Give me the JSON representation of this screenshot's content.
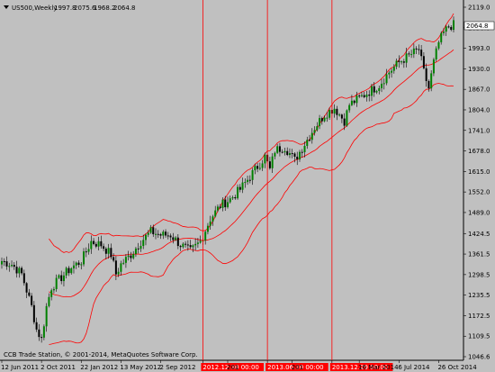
{
  "header": {
    "icon": "dropdown-triangle-icon",
    "symbol": "US500,Weekly",
    "open": "1997.8",
    "high": "2075.6",
    "low": "1968.2",
    "close": "2064.8"
  },
  "footer": {
    "copyright": "CCB Trade Station, © 2001-2014, MetaQuotes Software Corp."
  },
  "current_price_label": "2064.8",
  "colors": {
    "background": "#c0c0c0",
    "bull_candle": "#008000",
    "bear_candle": "#000000",
    "bands": "#ff0000",
    "vertical_lines": "#ff0000",
    "tag_background": "#ff0000",
    "current_tag_background": "#ffffff"
  },
  "vertical_markers": [
    {
      "label": "2012.12.30 00:00"
    },
    {
      "label": "2013.06.30 00:00"
    },
    {
      "label": "2013.12.29 00:00"
    }
  ],
  "chart_data": {
    "type": "candlestick",
    "title": "US500,Weekly",
    "ylim": [
      1046.6,
      2119.0
    ],
    "y_ticks": [
      "2119.0",
      "2056.0",
      "1993.0",
      "1930.0",
      "1867.0",
      "1804.0",
      "1741.0",
      "1678.0",
      "1615.0",
      "1552.0",
      "1489.0",
      "1424.5",
      "1361.5",
      "1298.5",
      "1235.5",
      "1172.5",
      "1109.5",
      "1046.6"
    ],
    "x_ticks": [
      {
        "label": "12 Jun 2011",
        "week": 0
      },
      {
        "label": "2 Oct 2011",
        "week": 16
      },
      {
        "label": "22 Jan 2012",
        "week": 32
      },
      {
        "label": "13 May 2012",
        "week": 48
      },
      {
        "label": "2 Sep 2012",
        "week": 64
      },
      {
        "label": "2012.12.30 00:00",
        "week": 81,
        "marker": true
      },
      {
        "label": "201",
        "week": 91
      },
      {
        "label": "2013.06.30 00:00",
        "week": 107,
        "marker": true
      },
      {
        "label": "201",
        "week": 117
      },
      {
        "label": "2013.12.29 00:00",
        "week": 133,
        "marker": true
      },
      {
        "label": "16 Mar 2014",
        "week": 144
      },
      {
        "label": "6 Jul 2014",
        "week": 160
      },
      {
        "label": "26 Oct 2014",
        "week": 176
      }
    ],
    "indicators": [
      "Bollinger upper",
      "Moving average",
      "Bollinger lower"
    ],
    "approx_close_path": [
      [
        0,
        1340
      ],
      [
        4,
        1330
      ],
      [
        8,
        1300
      ],
      [
        12,
        1200
      ],
      [
        14,
        1130
      ],
      [
        16,
        1100
      ],
      [
        18,
        1200
      ],
      [
        20,
        1260
      ],
      [
        24,
        1290
      ],
      [
        28,
        1320
      ],
      [
        32,
        1340
      ],
      [
        36,
        1400
      ],
      [
        40,
        1390
      ],
      [
        44,
        1360
      ],
      [
        46,
        1300
      ],
      [
        48,
        1330
      ],
      [
        52,
        1360
      ],
      [
        56,
        1400
      ],
      [
        60,
        1430
      ],
      [
        64,
        1420
      ],
      [
        68,
        1420
      ],
      [
        72,
        1390
      ],
      [
        76,
        1370
      ],
      [
        80,
        1400
      ],
      [
        84,
        1470
      ],
      [
        88,
        1510
      ],
      [
        92,
        1530
      ],
      [
        96,
        1560
      ],
      [
        100,
        1600
      ],
      [
        104,
        1640
      ],
      [
        106,
        1660
      ],
      [
        108,
        1620
      ],
      [
        110,
        1680
      ],
      [
        114,
        1690
      ],
      [
        118,
        1650
      ],
      [
        122,
        1700
      ],
      [
        126,
        1750
      ],
      [
        130,
        1790
      ],
      [
        134,
        1810
      ],
      [
        138,
        1770
      ],
      [
        140,
        1820
      ],
      [
        144,
        1840
      ],
      [
        148,
        1860
      ],
      [
        152,
        1880
      ],
      [
        156,
        1920
      ],
      [
        160,
        1950
      ],
      [
        164,
        1970
      ],
      [
        168,
        1990
      ],
      [
        170,
        1920
      ],
      [
        172,
        1870
      ],
      [
        174,
        1950
      ],
      [
        176,
        2010
      ],
      [
        178,
        2040
      ],
      [
        180,
        2060
      ],
      [
        182,
        2064.8
      ]
    ]
  }
}
